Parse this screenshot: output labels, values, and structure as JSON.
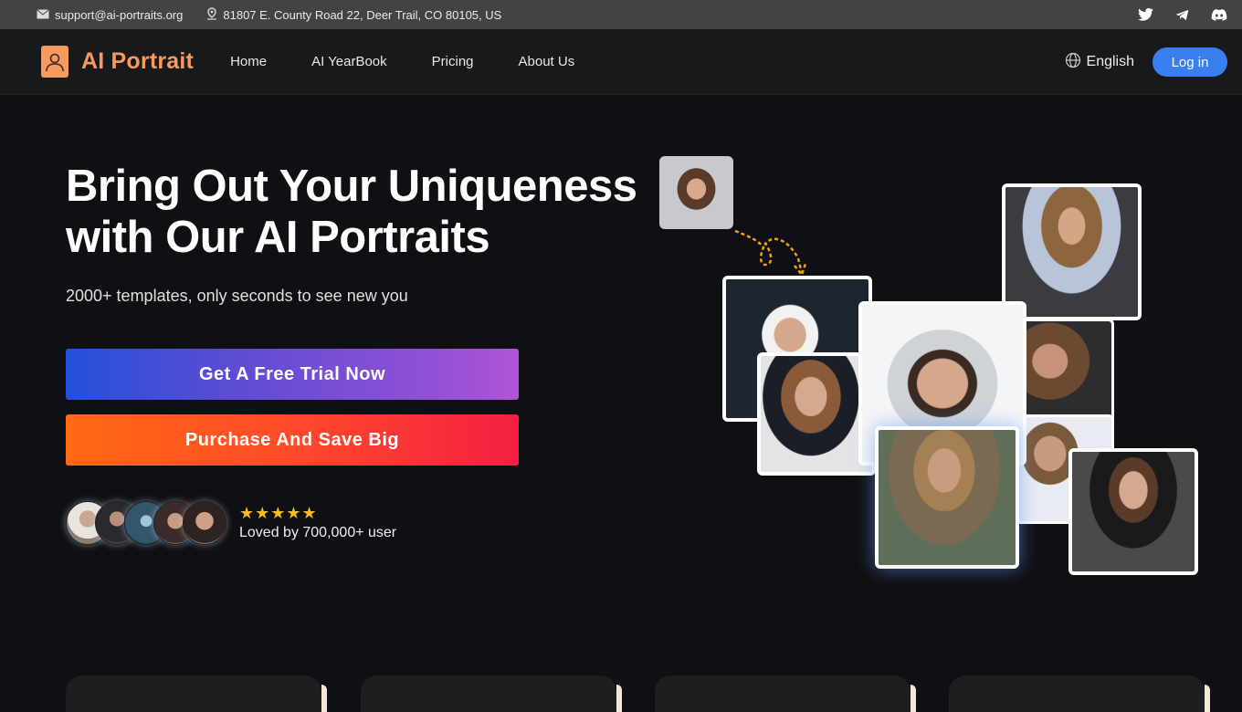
{
  "topbar": {
    "email": "support@ai-portraits.org",
    "address": "81807 E. County Road 22, Deer Trail, CO 80105, US",
    "icons": [
      "mail-icon",
      "location-pin-icon",
      "twitter-icon",
      "telegram-icon",
      "discord-icon"
    ]
  },
  "nav": {
    "brand": "AI Portrait",
    "links": [
      "Home",
      "AI YearBook",
      "Pricing",
      "About Us"
    ],
    "language": "English",
    "login_label": "Log in"
  },
  "hero": {
    "title_line1": "Bring Out Your Uniqueness",
    "title_line2": "with Our AI Portraits",
    "subtitle": "2000+ templates, only seconds to see new you",
    "trial_button": "Get A Free Trial Now",
    "purchase_button": "Purchase And Save Big",
    "stars": "★★★★★",
    "rating_count": 5,
    "loved_text": "Loved by 700,000+ user"
  },
  "gallery": {
    "source": "original-selfie",
    "portraits": [
      "navy-officer",
      "police-officer",
      "astronaut",
      "soldier",
      "doctor",
      "evening-portrait",
      "lab-doctor",
      "business-woman"
    ]
  },
  "colors": {
    "brand": "#f79a5d",
    "login": "#3a7ff0",
    "star": "#f7b928"
  }
}
